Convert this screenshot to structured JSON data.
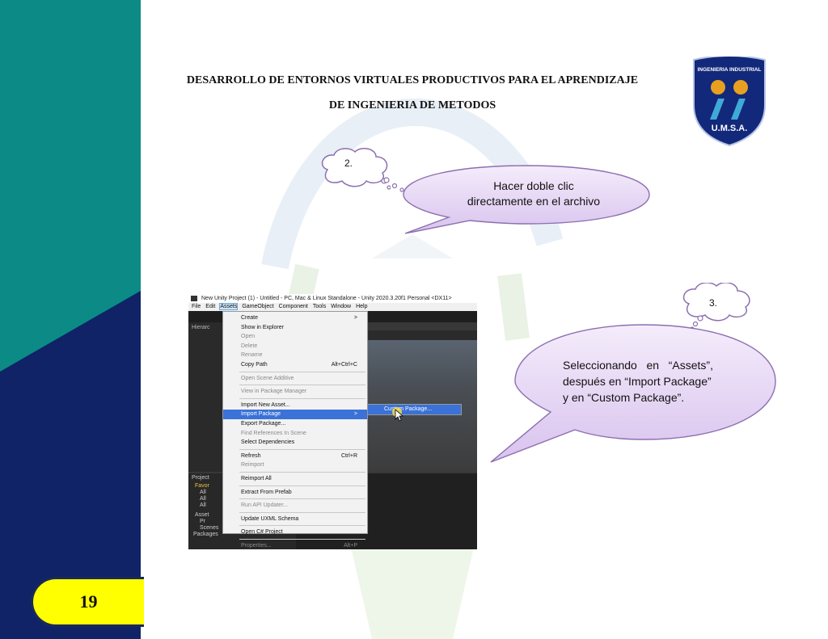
{
  "header": {
    "line1": "DESARROLLO DE ENTORNOS VIRTUALES PRODUCTIVOS PARA EL APRENDIZAJE",
    "line2": "DE INGENIERIA DE METODOS"
  },
  "logo": {
    "arc_text": "INGENIERIA INDUSTRIAL",
    "bottom_text": "U.M.S.A."
  },
  "callouts": {
    "step2_label": "2.",
    "step2_text_line1": "Hacer doble clic",
    "step2_text_line2": "directamente en el archivo",
    "step3_label": "3.",
    "step3_text_line1": "Seleccionando   en   “Assets”,",
    "step3_text_line2": "después en “Import Package”",
    "step3_text_line3": "y en “Custom Package”."
  },
  "page_number": "19",
  "unity": {
    "title": "New Unity Project (1) - Untitled - PC, Mac & Linux Standalone - Unity 2020.3.20f1 Personal <DX11>",
    "menubar": [
      "File",
      "Edit",
      "Assets",
      "GameObject",
      "Component",
      "Tools",
      "Window",
      "Help"
    ],
    "hierarchy_label": "Hierarc",
    "project_label": "Project",
    "project_items": [
      "Favor",
      "All",
      "All",
      "All",
      "Asset",
      "Pr",
      "Scenes",
      "Packages"
    ],
    "menu": {
      "create": "Create",
      "show_in_explorer": "Show in Explorer",
      "open": "Open",
      "delete": "Delete",
      "rename": "Rename",
      "copy_path": "Copy Path",
      "copy_path_shortcut": "Alt+Ctrl+C",
      "open_scene_additive": "Open Scene Additive",
      "view_in_package_manager": "View in Package Manager",
      "import_new_asset": "Import New Asset...",
      "import_package": "Import Package",
      "export_package": "Export Package...",
      "find_references": "Find References In Scene",
      "select_dependencies": "Select Dependencies",
      "refresh": "Refresh",
      "refresh_shortcut": "Ctrl+R",
      "reimport": "Reimport",
      "reimport_all": "Reimport All",
      "extract_from_prefab": "Extract From Prefab",
      "run_api_updater": "Run API Updater...",
      "update_uxml_schema": "Update UXML Schema",
      "open_csharp_project": "Open C# Project",
      "properties": "Properties...",
      "properties_shortcut": "Alt+P",
      "submenu_arrow": ">"
    },
    "submenu_custom_package": "Custom Package..."
  },
  "colors": {
    "teal": "#0b8a86",
    "navy": "#0f2366",
    "yellow": "#ffff00",
    "callout_fill": "#e4d2f2",
    "callout_stroke": "#8c6fb0",
    "menu_highlight": "#3a72d8"
  }
}
